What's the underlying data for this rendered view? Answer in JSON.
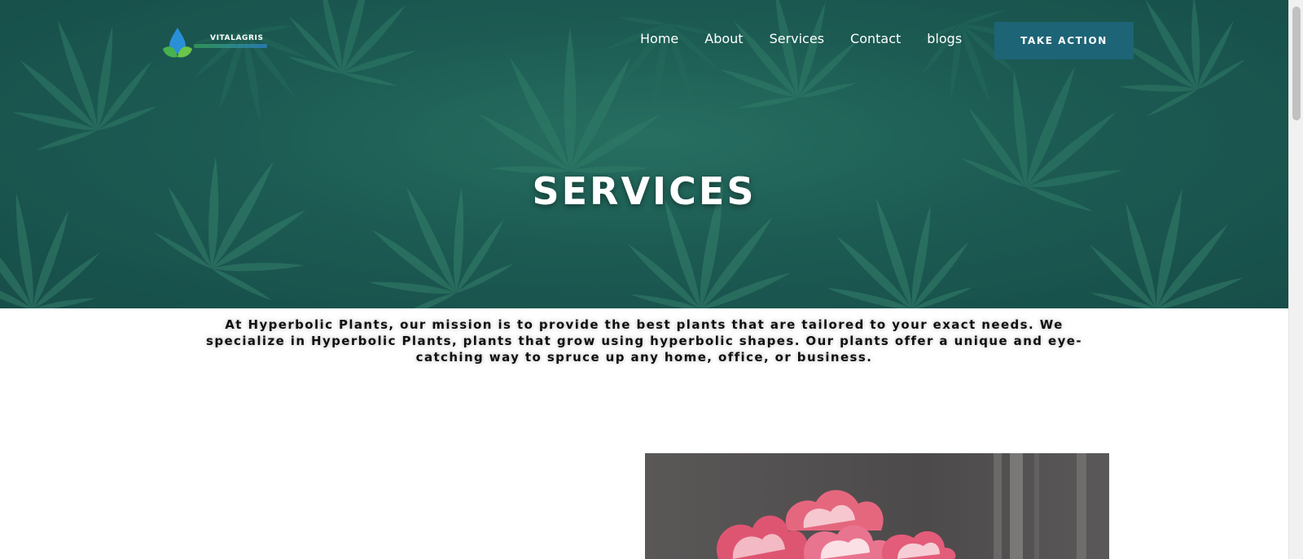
{
  "brand": {
    "name": "VITALAGRIS",
    "logo_icon": "water-drop-leaf-icon"
  },
  "nav": {
    "items": [
      {
        "label": "Home"
      },
      {
        "label": "About"
      },
      {
        "label": "Services"
      },
      {
        "label": "Contact"
      },
      {
        "label": "blogs"
      }
    ],
    "cta_label": "TAKE ACTION"
  },
  "hero": {
    "title": "SERVICES",
    "background": "cannabis-leaves-photo"
  },
  "mission": {
    "text": "At Hyperbolic Plants, our mission is to provide the best plants that are tailored to your exact needs. We specialize in Hyperbolic Plants, plants that grow using hyperbolic shapes. Our plants offer a unique and eye-catching way to spruce up any home, office, or business."
  },
  "media": {
    "flower_image": "pink-tulips-photo"
  },
  "colors": {
    "cta": "#1d6476",
    "hero_tint": "#1f5f55"
  }
}
